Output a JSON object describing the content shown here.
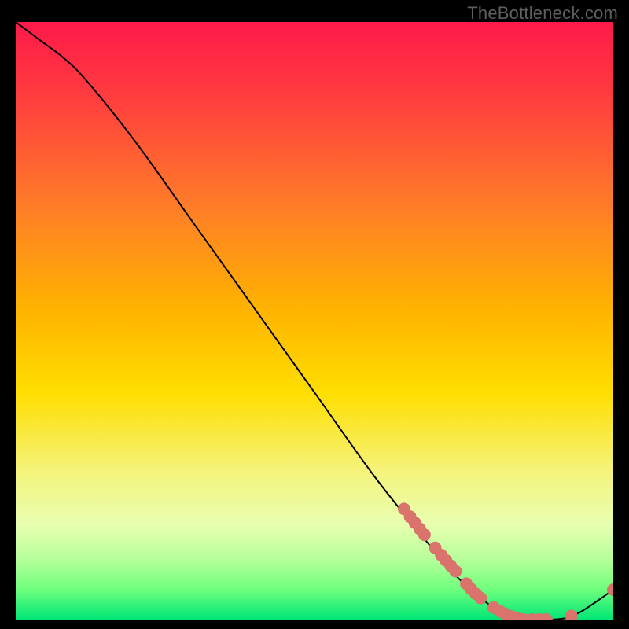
{
  "watermark": "TheBottleneck.com",
  "colors": {
    "page_bg": "#000000",
    "grad_top": "#ff1a4a",
    "grad_yellow": "#ffd400",
    "grad_green_light": "#7aff66",
    "grad_green": "#00e676",
    "curve": "#000000",
    "dot_fill": "#d9736b",
    "dot_stroke": "#b85850"
  },
  "chart_data": {
    "type": "line",
    "title": "",
    "xlabel": "",
    "ylabel": "",
    "xlim": [
      0,
      100
    ],
    "ylim": [
      0,
      100
    ],
    "legend": false,
    "grid": false,
    "curve": [
      {
        "x": 0,
        "y": 100
      },
      {
        "x": 4,
        "y": 97
      },
      {
        "x": 8,
        "y": 94
      },
      {
        "x": 12,
        "y": 90
      },
      {
        "x": 20,
        "y": 80
      },
      {
        "x": 30,
        "y": 66
      },
      {
        "x": 40,
        "y": 52
      },
      {
        "x": 50,
        "y": 38
      },
      {
        "x": 60,
        "y": 24
      },
      {
        "x": 68,
        "y": 14
      },
      {
        "x": 74,
        "y": 7
      },
      {
        "x": 80,
        "y": 2
      },
      {
        "x": 85,
        "y": 0
      },
      {
        "x": 90,
        "y": 0
      },
      {
        "x": 94,
        "y": 1
      },
      {
        "x": 100,
        "y": 5
      }
    ],
    "highlight_points": [
      {
        "x": 65,
        "y": 18.5
      },
      {
        "x": 66,
        "y": 17.2
      },
      {
        "x": 66.8,
        "y": 16.2
      },
      {
        "x": 67.6,
        "y": 15.2
      },
      {
        "x": 68.4,
        "y": 14.2
      },
      {
        "x": 70.2,
        "y": 12.0
      },
      {
        "x": 71.2,
        "y": 10.8
      },
      {
        "x": 72.0,
        "y": 9.9
      },
      {
        "x": 72.8,
        "y": 9.0
      },
      {
        "x": 73.6,
        "y": 8.1
      },
      {
        "x": 75.4,
        "y": 6.0
      },
      {
        "x": 76.2,
        "y": 5.1
      },
      {
        "x": 77.0,
        "y": 4.3
      },
      {
        "x": 77.8,
        "y": 3.6
      },
      {
        "x": 80.0,
        "y": 2.0
      },
      {
        "x": 81.0,
        "y": 1.4
      },
      {
        "x": 82.0,
        "y": 0.9
      },
      {
        "x": 83.0,
        "y": 0.5
      },
      {
        "x": 84.0,
        "y": 0.2
      },
      {
        "x": 85.0,
        "y": 0.0
      },
      {
        "x": 86.4,
        "y": 0.0
      },
      {
        "x": 87.6,
        "y": 0.0
      },
      {
        "x": 88.8,
        "y": 0.0
      },
      {
        "x": 93.0,
        "y": 0.6
      },
      {
        "x": 100.0,
        "y": 5.0
      }
    ]
  }
}
